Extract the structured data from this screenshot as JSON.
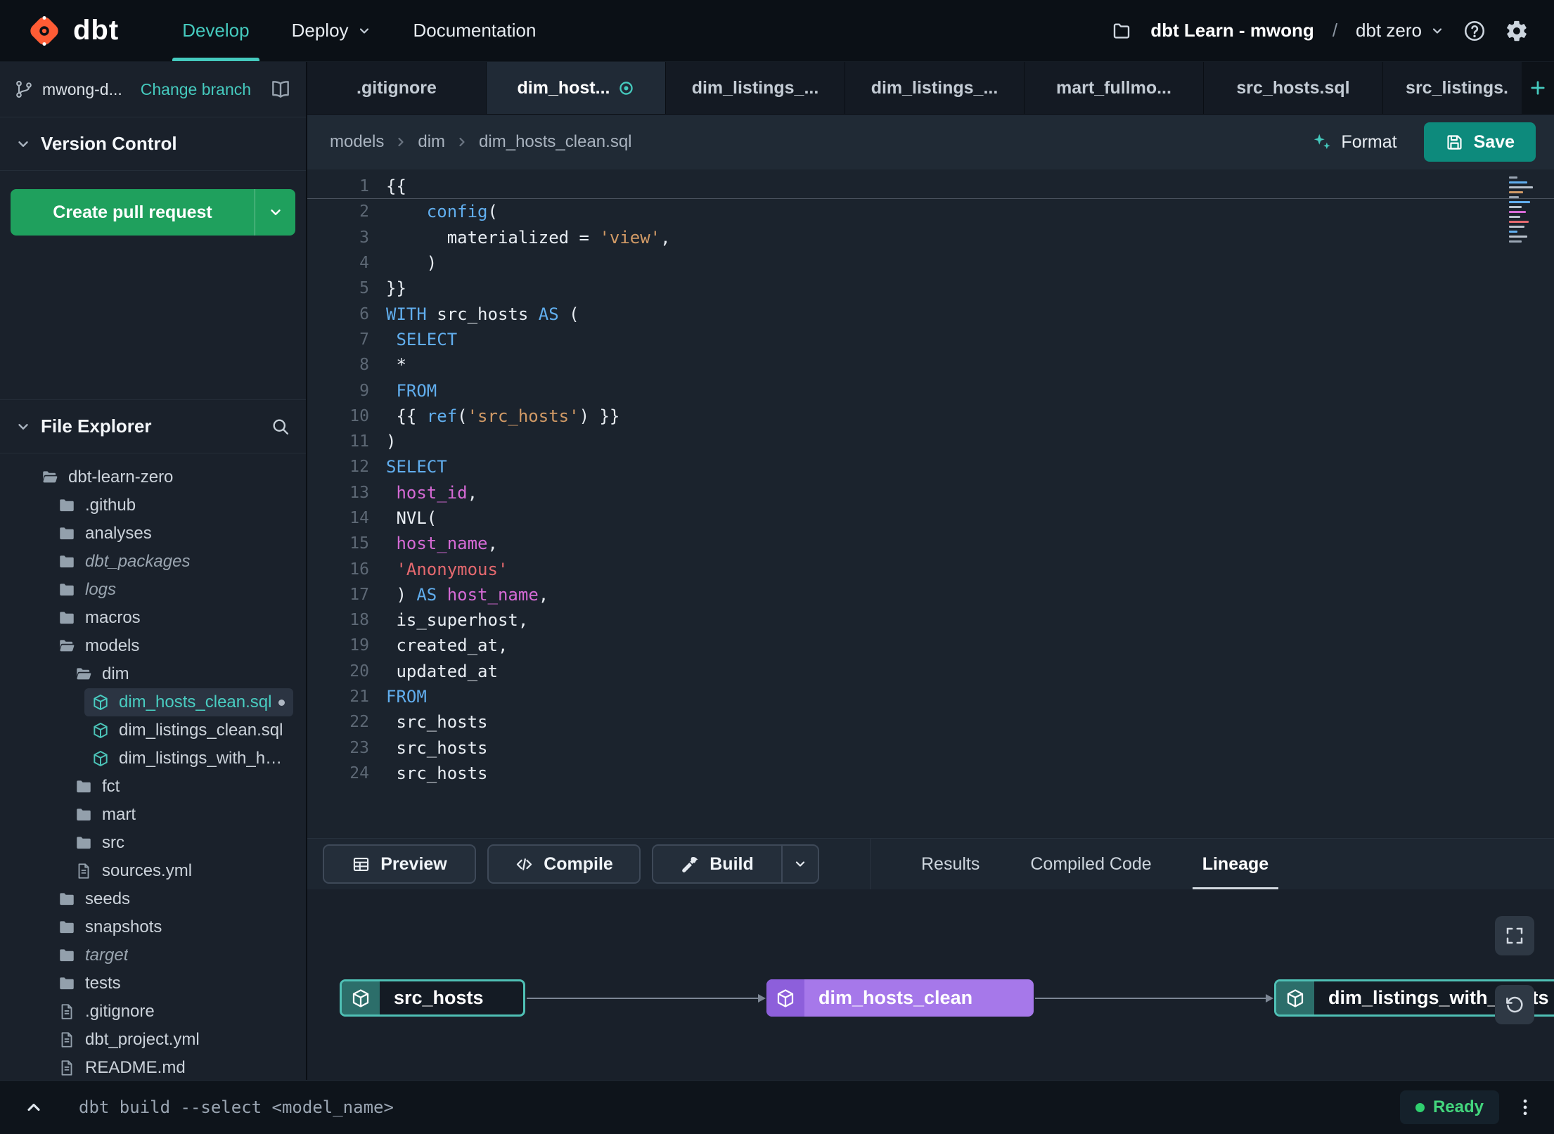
{
  "navbar": {
    "brand": "dbt",
    "menu": [
      {
        "label": "Develop",
        "active": true,
        "chevron": false
      },
      {
        "label": "Deploy",
        "active": false,
        "chevron": true
      },
      {
        "label": "Documentation",
        "active": false,
        "chevron": false
      }
    ],
    "project_label": "dbt Learn - mwong",
    "separator": "/",
    "environment": "dbt zero"
  },
  "sidebar": {
    "branch_name": "mwong-d...",
    "change_branch_label": "Change branch",
    "version_control_label": "Version Control",
    "create_pr_label": "Create pull request",
    "file_explorer_label": "File Explorer",
    "tree": [
      {
        "label": "dbt-learn-zero",
        "icon": "folder-open-icon",
        "depth": 0
      },
      {
        "label": ".github",
        "icon": "folder-icon",
        "depth": 1
      },
      {
        "label": "analyses",
        "icon": "folder-icon",
        "depth": 1
      },
      {
        "label": "dbt_packages",
        "icon": "folder-icon",
        "depth": 1,
        "italic": true
      },
      {
        "label": "logs",
        "icon": "folder-icon",
        "depth": 1,
        "italic": true
      },
      {
        "label": "macros",
        "icon": "folder-icon",
        "depth": 1
      },
      {
        "label": "models",
        "icon": "folder-open-icon",
        "depth": 1
      },
      {
        "label": "dim",
        "icon": "folder-open-icon",
        "depth": 2
      },
      {
        "label": "dim_hosts_clean.sql",
        "icon": "model-icon",
        "depth": 3,
        "active": true,
        "dirty": true
      },
      {
        "label": "dim_listings_clean.sql",
        "icon": "model-icon",
        "depth": 3
      },
      {
        "label": "dim_listings_with_hosts...",
        "icon": "model-icon",
        "depth": 3
      },
      {
        "label": "fct",
        "icon": "folder-icon",
        "depth": 2
      },
      {
        "label": "mart",
        "icon": "folder-icon",
        "depth": 2
      },
      {
        "label": "src",
        "icon": "folder-icon",
        "depth": 2
      },
      {
        "label": "sources.yml",
        "icon": "file-icon",
        "depth": 2
      },
      {
        "label": "seeds",
        "icon": "folder-icon",
        "depth": 1
      },
      {
        "label": "snapshots",
        "icon": "folder-icon",
        "depth": 1
      },
      {
        "label": "target",
        "icon": "folder-icon",
        "depth": 1,
        "italic": true
      },
      {
        "label": "tests",
        "icon": "folder-icon",
        "depth": 1
      },
      {
        "label": ".gitignore",
        "icon": "file-icon",
        "depth": 1
      },
      {
        "label": "dbt_project.yml",
        "icon": "file-icon",
        "depth": 1
      },
      {
        "label": "README.md",
        "icon": "file-icon",
        "depth": 1
      }
    ]
  },
  "tabs": {
    "items": [
      {
        "label": ".gitignore"
      },
      {
        "label": "dim_host...",
        "active": true,
        "dirty": true
      },
      {
        "label": "dim_listings_..."
      },
      {
        "label": "dim_listings_..."
      },
      {
        "label": "mart_fullmo..."
      },
      {
        "label": "src_hosts.sql"
      },
      {
        "label": "src_listings."
      }
    ]
  },
  "breadcrumb": {
    "items": [
      "models",
      "dim",
      "dim_hosts_clean.sql"
    ]
  },
  "editor_actions": {
    "format_label": "Format",
    "save_label": "Save"
  },
  "editor": {
    "lines": [
      {
        "n": "1",
        "tokens": [
          {
            "t": "{{",
            "c": "p"
          }
        ]
      },
      {
        "n": "2",
        "tokens": [
          {
            "t": "    ",
            "c": "p"
          },
          {
            "t": "config",
            "c": "k"
          },
          {
            "t": "(",
            "c": "p"
          }
        ]
      },
      {
        "n": "3",
        "tokens": [
          {
            "t": "      materialized = ",
            "c": "p"
          },
          {
            "t": "'view'",
            "c": "s"
          },
          {
            "t": ",",
            "c": "p"
          }
        ]
      },
      {
        "n": "4",
        "tokens": [
          {
            "t": "    )",
            "c": "p"
          }
        ]
      },
      {
        "n": "5",
        "tokens": [
          {
            "t": "}}",
            "c": "p"
          }
        ]
      },
      {
        "n": "6",
        "tokens": [
          {
            "t": "WITH",
            "c": "k"
          },
          {
            "t": " src_hosts ",
            "c": "p"
          },
          {
            "t": "AS",
            "c": "k"
          },
          {
            "t": " (",
            "c": "p"
          }
        ]
      },
      {
        "n": "7",
        "tokens": [
          {
            "t": " ",
            "c": "p"
          },
          {
            "t": "SELECT",
            "c": "k"
          }
        ]
      },
      {
        "n": "8",
        "tokens": [
          {
            "t": " *",
            "c": "p"
          }
        ]
      },
      {
        "n": "9",
        "tokens": [
          {
            "t": " ",
            "c": "p"
          },
          {
            "t": "FROM",
            "c": "k"
          }
        ]
      },
      {
        "n": "10",
        "tokens": [
          {
            "t": " {{ ",
            "c": "p"
          },
          {
            "t": "ref",
            "c": "k"
          },
          {
            "t": "(",
            "c": "p"
          },
          {
            "t": "'src_hosts'",
            "c": "s"
          },
          {
            "t": ") }}",
            "c": "p"
          }
        ]
      },
      {
        "n": "11",
        "tokens": [
          {
            "t": ")",
            "c": "p"
          }
        ]
      },
      {
        "n": "12",
        "tokens": [
          {
            "t": "SELECT",
            "c": "k"
          }
        ]
      },
      {
        "n": "13",
        "tokens": [
          {
            "t": " ",
            "c": "p"
          },
          {
            "t": "host_id",
            "c": "c"
          },
          {
            "t": ",",
            "c": "p"
          }
        ]
      },
      {
        "n": "14",
        "tokens": [
          {
            "t": " NVL(",
            "c": "p"
          }
        ]
      },
      {
        "n": "15",
        "tokens": [
          {
            "t": " ",
            "c": "p"
          },
          {
            "t": "host_name",
            "c": "c"
          },
          {
            "t": ",",
            "c": "p"
          }
        ]
      },
      {
        "n": "16",
        "tokens": [
          {
            "t": " ",
            "c": "p"
          },
          {
            "t": "'Anonymous'",
            "c": "s2"
          }
        ]
      },
      {
        "n": "17",
        "tokens": [
          {
            "t": " ) ",
            "c": "p"
          },
          {
            "t": "AS",
            "c": "k"
          },
          {
            "t": " ",
            "c": "p"
          },
          {
            "t": "host_name",
            "c": "c"
          },
          {
            "t": ",",
            "c": "p"
          }
        ]
      },
      {
        "n": "18",
        "tokens": [
          {
            "t": " is_superhost,",
            "c": "p"
          }
        ]
      },
      {
        "n": "19",
        "tokens": [
          {
            "t": " created_at,",
            "c": "p"
          }
        ]
      },
      {
        "n": "20",
        "tokens": [
          {
            "t": " updated_at",
            "c": "p"
          }
        ]
      },
      {
        "n": "21",
        "tokens": [
          {
            "t": "FROM",
            "c": "k"
          }
        ]
      },
      {
        "n": "22",
        "tokens": [
          {
            "t": " src_hosts",
            "c": "p"
          }
        ]
      },
      {
        "n": "23",
        "tokens": [
          {
            "t": " src_hosts",
            "c": "p"
          }
        ]
      },
      {
        "n": "24",
        "tokens": [
          {
            "t": " src_hosts",
            "c": "p"
          }
        ]
      }
    ]
  },
  "bottom_toolbar": {
    "buttons": [
      {
        "label": "Preview",
        "icon": "table-icon",
        "split": false
      },
      {
        "label": "Compile",
        "icon": "code-icon",
        "split": false
      },
      {
        "label": "Build",
        "icon": "hammer-icon",
        "split": true
      }
    ],
    "tabs": [
      {
        "label": "Results",
        "active": false
      },
      {
        "label": "Compiled Code",
        "active": false
      },
      {
        "label": "Lineage",
        "active": true
      }
    ]
  },
  "lineage": {
    "nodes": [
      {
        "label": "src_hosts",
        "color": "teal"
      },
      {
        "label": "dim_hosts_clean",
        "color": "purple"
      },
      {
        "label": "dim_listings_with_hosts",
        "color": "teal"
      }
    ]
  },
  "statusbar": {
    "command": "dbt build --select <model_name>",
    "status": "Ready"
  },
  "colors": {
    "accent_teal": "#45cabe",
    "brand_orange": "#ff5c35",
    "pr_green": "#1fa05d",
    "node_purple": "#a678ea",
    "ready_green": "#2fd06f",
    "save_teal": "#0d8a7c"
  }
}
